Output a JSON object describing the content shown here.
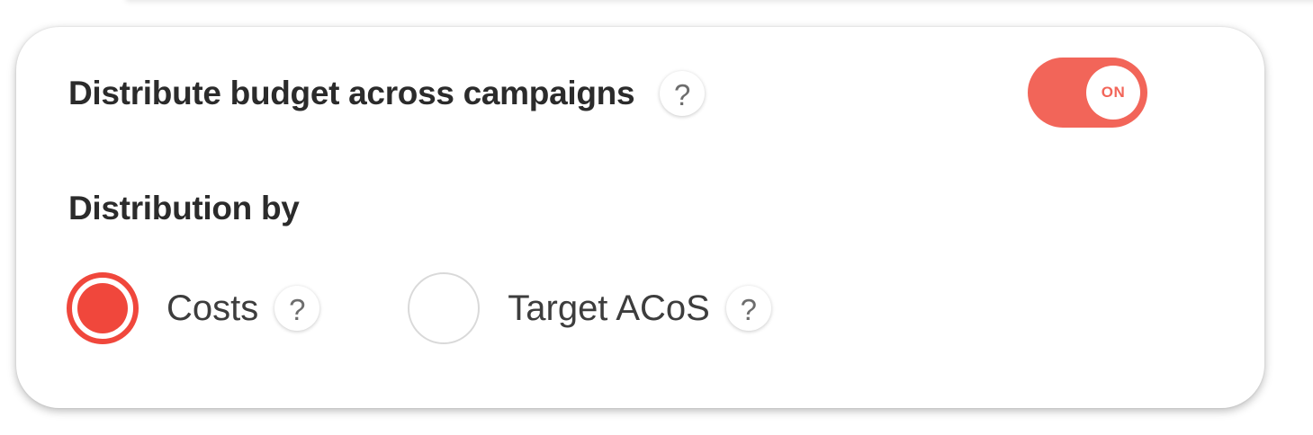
{
  "budget_distribution": {
    "heading": "Distribute budget across campaigns",
    "help_glyph": "?",
    "toggle": {
      "state": true,
      "label": "ON",
      "color": "#f26559"
    }
  },
  "distribution_by": {
    "heading": "Distribution by",
    "options": [
      {
        "label": "Costs",
        "selected": true,
        "help_glyph": "?"
      },
      {
        "label": "Target ACoS",
        "selected": false,
        "help_glyph": "?"
      }
    ],
    "accent_color": "#f0473c"
  },
  "icons": {
    "help": "question-mark-icon"
  }
}
